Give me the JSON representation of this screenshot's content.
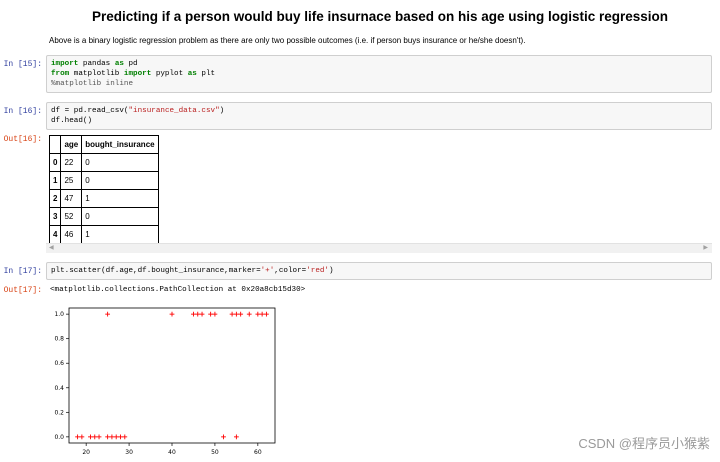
{
  "title": "Predicting if a person would buy life insurnace based on his age using logistic regression",
  "description": "Above is a binary logistic regression problem as there are only two possible outcomes (i.e. if person buys insurance or he/she doesn't).",
  "cells": {
    "c15": {
      "prompt": "In  [15]:",
      "line1_kw1": "import",
      "line1_rest1": " pandas ",
      "line1_kw2": "as",
      "line1_rest2": " pd",
      "line2_kw1": "from",
      "line2_rest1": " matplotlib ",
      "line2_kw2": "import",
      "line2_rest2": " pyplot ",
      "line2_kw3": "as",
      "line2_rest3": " plt",
      "line3": "%matplotlib inline"
    },
    "c16": {
      "prompt": "In  [16]:",
      "out_prompt": "Out[16]:",
      "line1_a": "df = pd.read_csv(",
      "line1_str": "\"insurance_data.csv\"",
      "line1_b": ")",
      "line2": "df.head()"
    },
    "c17": {
      "prompt": "In  [17]:",
      "out_prompt": "Out[17]:",
      "line1_a": "plt.scatter(df.age,df.bought_insurance,marker=",
      "line1_str1": "'+'",
      "line1_b": ",color=",
      "line1_str2": "'red'",
      "line1_c": ")",
      "output_text": "<matplotlib.collections.PathCollection at 0x20a8cb15d30>"
    }
  },
  "table": {
    "headers": [
      "",
      "age",
      "bought_insurance"
    ],
    "rows": [
      [
        "0",
        "22",
        "0"
      ],
      [
        "1",
        "25",
        "0"
      ],
      [
        "2",
        "47",
        "1"
      ],
      [
        "3",
        "52",
        "0"
      ],
      [
        "4",
        "46",
        "1"
      ]
    ]
  },
  "scrollbar": {
    "left_arrow": "◀",
    "right_arrow": "▶"
  },
  "chart_data": {
    "type": "scatter",
    "marker": "+",
    "color": "#ff0000",
    "xlim": [
      16,
      64
    ],
    "ylim": [
      -0.05,
      1.05
    ],
    "xticks": [
      20,
      30,
      40,
      50,
      60
    ],
    "yticks": [
      0.0,
      0.2,
      0.4,
      0.6,
      0.8,
      1.0
    ],
    "xtick_labels": [
      "20",
      "30",
      "40",
      "50",
      "60"
    ],
    "ytick_labels": [
      "0.0",
      "0.2",
      "0.4",
      "0.6",
      "0.8",
      "1.0"
    ],
    "x": [
      18,
      19,
      21,
      22,
      23,
      25,
      26,
      27,
      28,
      29,
      52,
      55,
      25,
      40,
      45,
      46,
      47,
      49,
      50,
      54,
      55,
      56,
      58,
      60,
      61,
      62
    ],
    "y": [
      0,
      0,
      0,
      0,
      0,
      0,
      0,
      0,
      0,
      0,
      0,
      0,
      1,
      1,
      1,
      1,
      1,
      1,
      1,
      1,
      1,
      1,
      1,
      1,
      1,
      1
    ]
  },
  "watermark": "CSDN @程序员小猴紫"
}
